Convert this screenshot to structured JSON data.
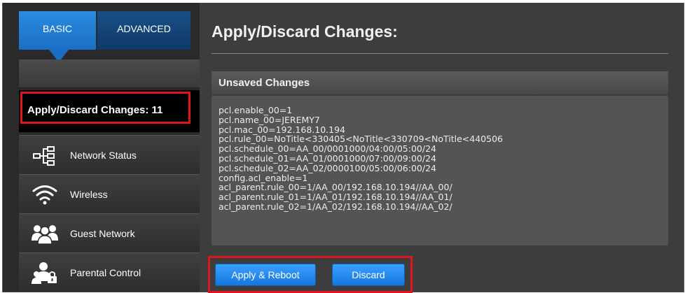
{
  "tabs": {
    "basic": "BASIC",
    "advanced": "ADVANCED"
  },
  "sidebar": {
    "active_item": "Apply/Discard Changes: 11",
    "items": [
      {
        "label": "Network Status",
        "icon": "network-status-icon"
      },
      {
        "label": "Wireless",
        "icon": "wifi-icon"
      },
      {
        "label": "Guest Network",
        "icon": "guest-network-icon"
      },
      {
        "label": "Parental Control",
        "icon": "parental-control-icon"
      }
    ]
  },
  "main": {
    "title": "Apply/Discard Changes:",
    "panel_title": "Unsaved Changes",
    "changes": [
      "pcl.enable_00=1",
      "pcl.name_00=JEREMY7",
      "pcl.mac_00=192.168.10.194",
      "pcl.rule_00=NoTitle<330405<NoTitle<330709<NoTitle<440506",
      "pcl.schedule_00=AA_00/0001000/04:00/05:00/24",
      "pcl.schedule_01=AA_01/0001000/07:00/09:00/24",
      "pcl.schedule_02=AA_02/0000100/05:00/06:00/24",
      "config.acl_enable=1",
      "acl_parent.rule_00=1/AA_00/192.168.10.194//AA_00/",
      "acl_parent.rule_01=1/AA_01/192.168.10.194//AA_01/",
      "acl_parent.rule_02=1/AA_02/192.168.10.194//AA_02/"
    ],
    "apply_label": "Apply & Reboot",
    "discard_label": "Discard"
  },
  "colors": {
    "accent": "#1a6fc4",
    "highlight": "#e0141e"
  }
}
